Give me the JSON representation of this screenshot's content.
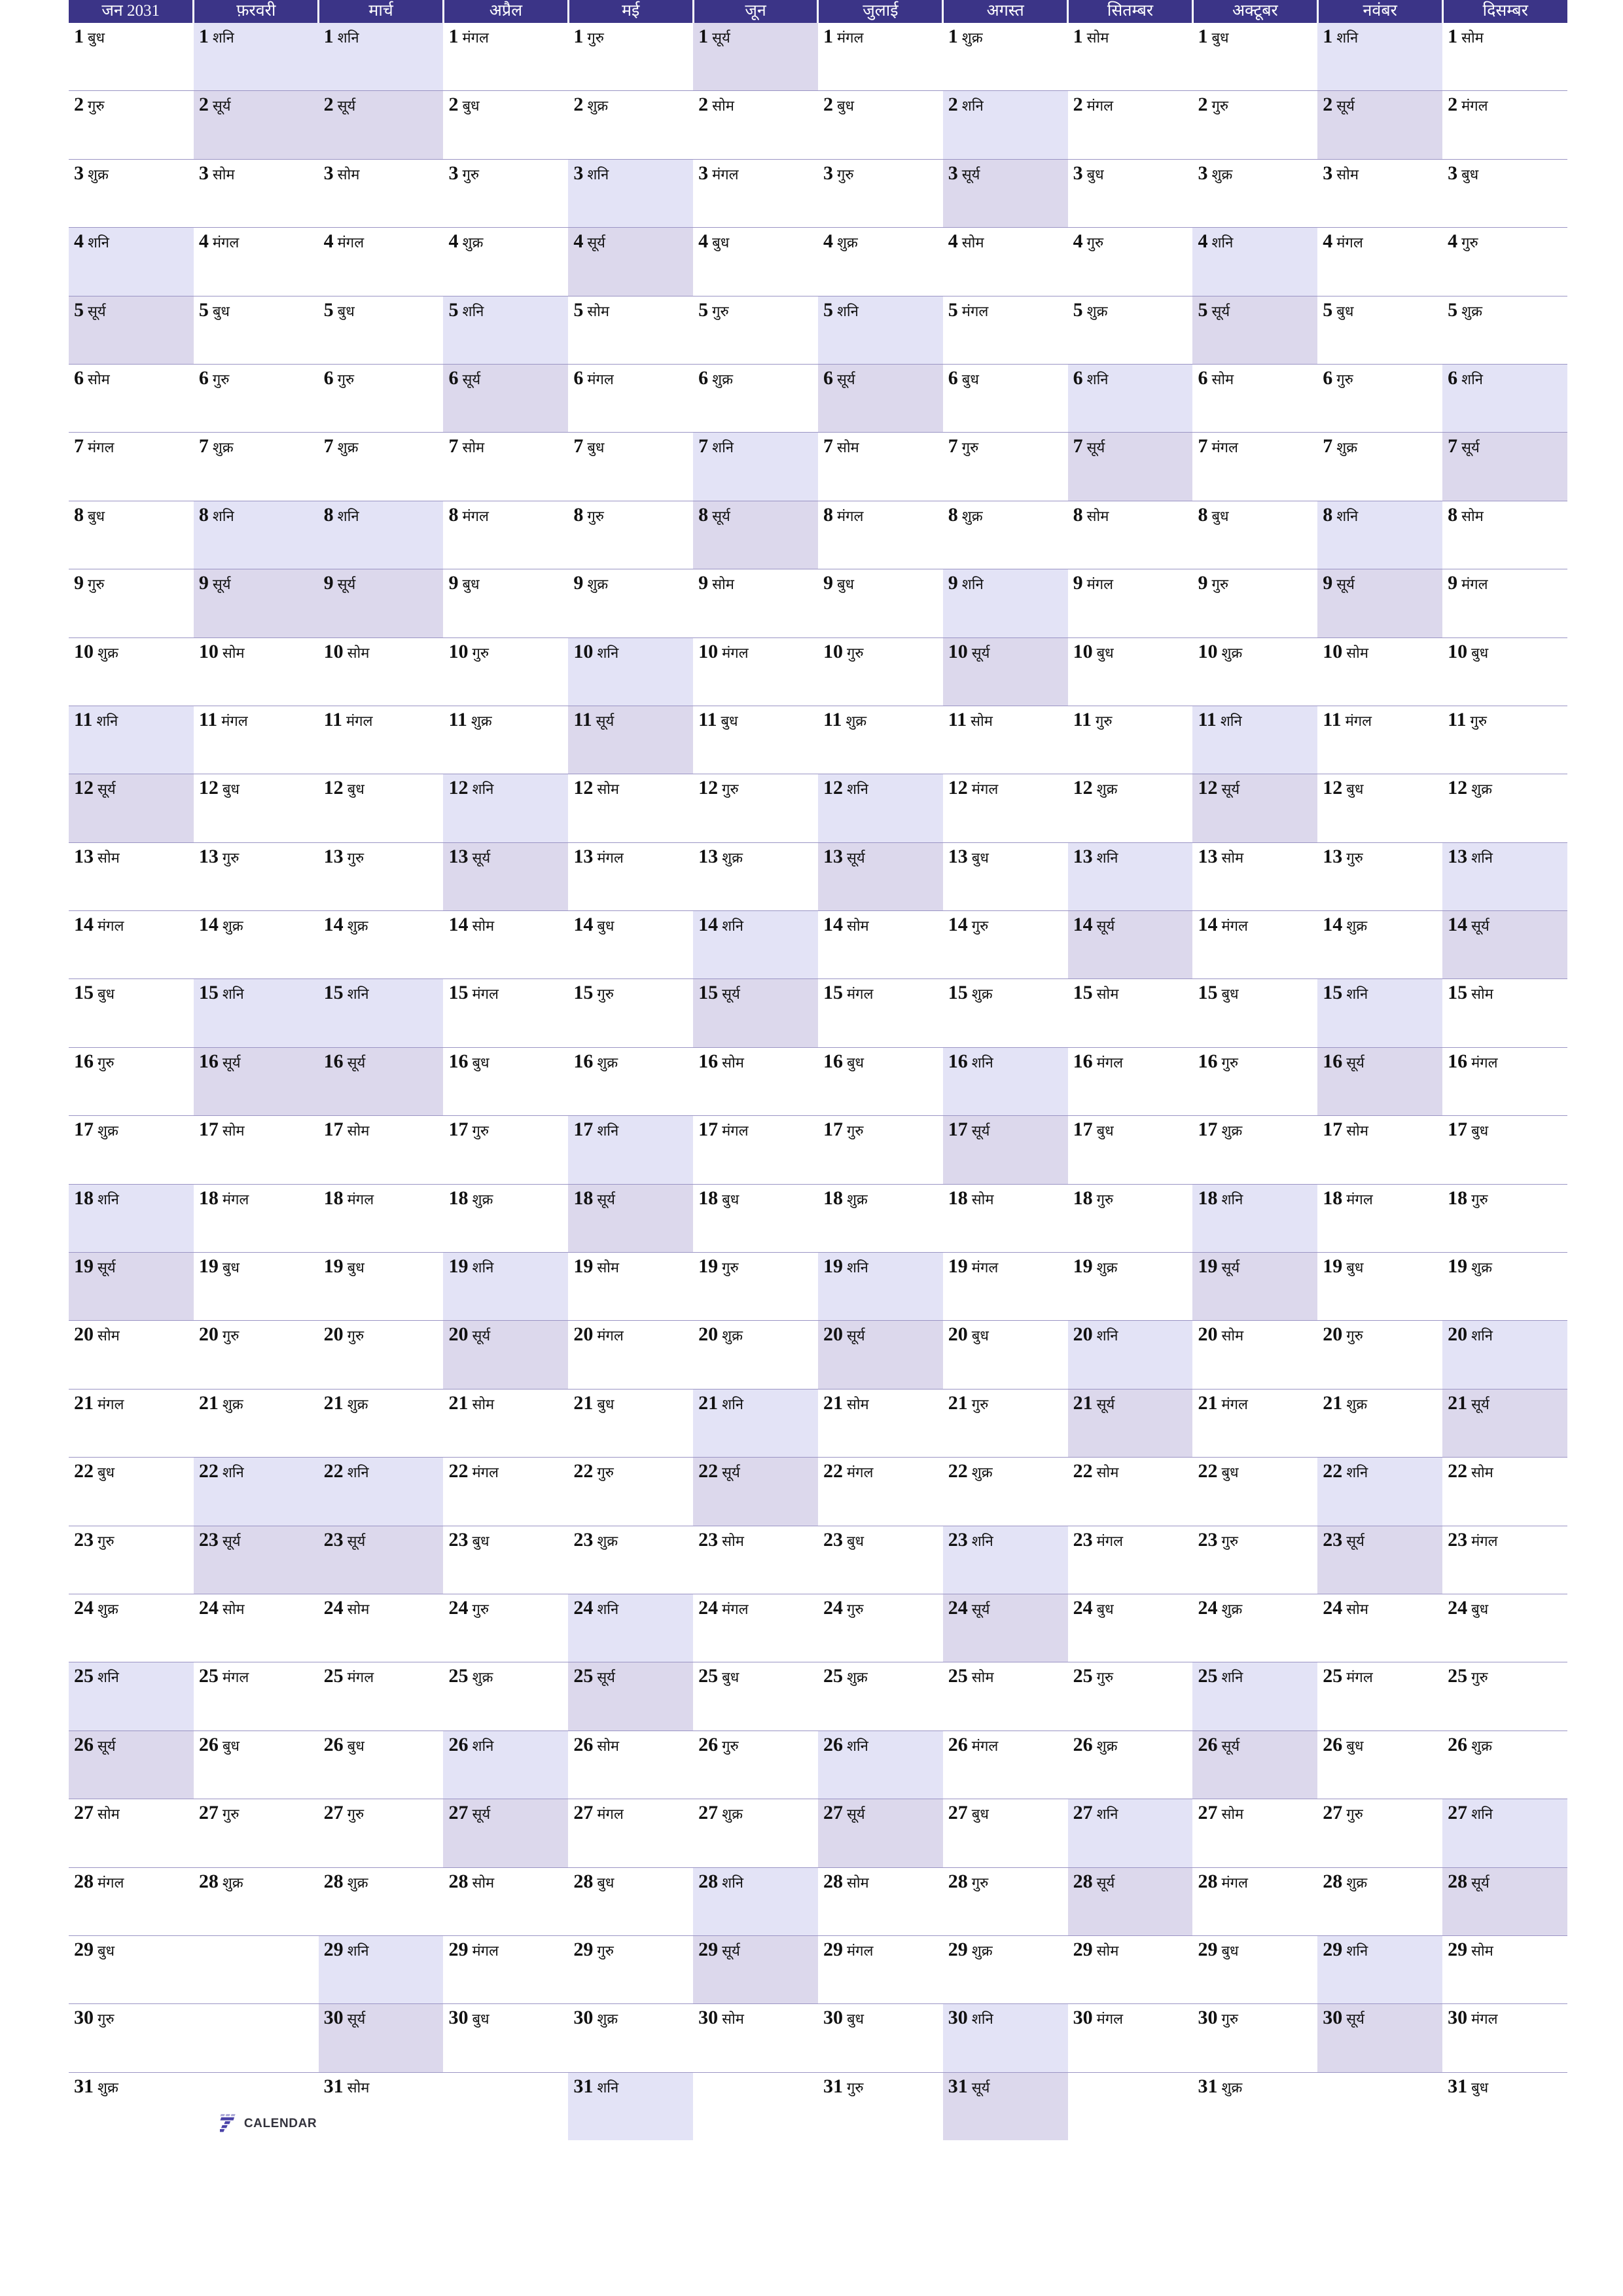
{
  "document": {
    "title": "जन 2031",
    "year": 2031,
    "language": "hi",
    "type": "linear-year-calendar"
  },
  "theme": {
    "header_bg": "#3b3487",
    "header_fg": "#ffffff",
    "saturday_bg": "#e3e3f6",
    "sunday_bg": "#dcd8ec",
    "gridline": "#9a94c4",
    "page_bg": "#ffffff",
    "text": "#111111"
  },
  "weekday_names": {
    "sun": "सूर्य",
    "mon": "सोम",
    "tue": "मंगल",
    "wed": "बुध",
    "thu": "गुरु",
    "fri": "शुक्र",
    "sat": "शनि"
  },
  "months": [
    {
      "index": 1,
      "label": "जन 2031",
      "days": 31,
      "first_weekday": 3
    },
    {
      "index": 2,
      "label": "फ़रवरी",
      "days": 28,
      "first_weekday": 6
    },
    {
      "index": 3,
      "label": "मार्च",
      "days": 31,
      "first_weekday": 6
    },
    {
      "index": 4,
      "label": "अप्रैल",
      "days": 30,
      "first_weekday": 2
    },
    {
      "index": 5,
      "label": "मई",
      "days": 31,
      "first_weekday": 4
    },
    {
      "index": 6,
      "label": "जून",
      "days": 30,
      "first_weekday": 0
    },
    {
      "index": 7,
      "label": "जुलाई",
      "days": 31,
      "first_weekday": 2
    },
    {
      "index": 8,
      "label": "अगस्त",
      "days": 31,
      "first_weekday": 5
    },
    {
      "index": 9,
      "label": "सितम्बर",
      "days": 30,
      "first_weekday": 1
    },
    {
      "index": 10,
      "label": "अक्टूबर",
      "days": 31,
      "first_weekday": 3
    },
    {
      "index": 11,
      "label": "नवंबर",
      "days": 30,
      "first_weekday": 6
    },
    {
      "index": 12,
      "label": "दिसम्बर",
      "days": 31,
      "first_weekday": 1
    }
  ],
  "rows": 31,
  "logo": {
    "numeral": "7",
    "text": "CALENDAR",
    "mark_color": "#4a43a8",
    "text_color": "#33333d",
    "placed_in_month": 2,
    "placed_in_row": 31
  }
}
